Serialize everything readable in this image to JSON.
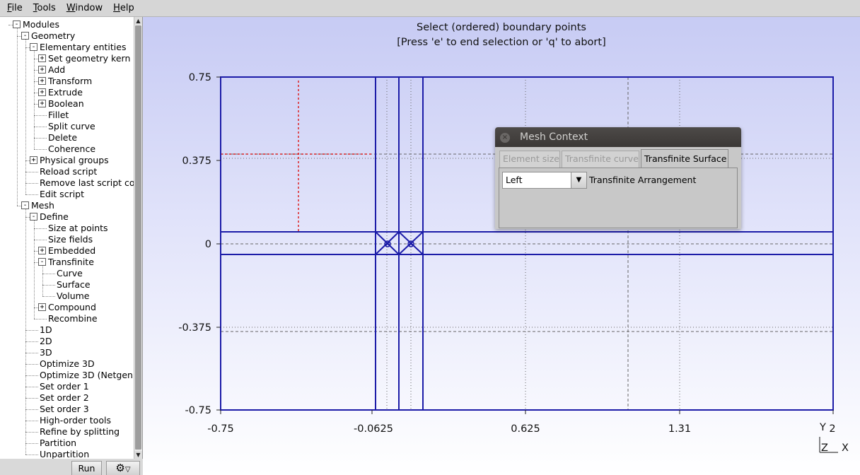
{
  "menu": {
    "items": [
      {
        "label_u": "F",
        "label_rest": "ile"
      },
      {
        "label_u": "T",
        "label_rest": "ools"
      },
      {
        "label_u": "W",
        "label_rest": "indow"
      },
      {
        "label_u": "H",
        "label_rest": "elp"
      }
    ]
  },
  "tree": {
    "items": [
      {
        "label": "Modules",
        "depth": 0,
        "toggle": "-"
      },
      {
        "label": "Geometry",
        "depth": 1,
        "toggle": "-"
      },
      {
        "label": "Elementary entities",
        "depth": 2,
        "toggle": "-"
      },
      {
        "label": "Set geometry kern",
        "depth": 3,
        "toggle": "+"
      },
      {
        "label": "Add",
        "depth": 3,
        "toggle": "+"
      },
      {
        "label": "Transform",
        "depth": 3,
        "toggle": "+"
      },
      {
        "label": "Extrude",
        "depth": 3,
        "toggle": "+"
      },
      {
        "label": "Boolean",
        "depth": 3,
        "toggle": "+"
      },
      {
        "label": "Fillet",
        "depth": 3,
        "toggle": ""
      },
      {
        "label": "Split curve",
        "depth": 3,
        "toggle": ""
      },
      {
        "label": "Delete",
        "depth": 3,
        "toggle": ""
      },
      {
        "label": "Coherence",
        "depth": 3,
        "toggle": ""
      },
      {
        "label": "Physical groups",
        "depth": 2,
        "toggle": "+"
      },
      {
        "label": "Reload script",
        "depth": 2,
        "toggle": ""
      },
      {
        "label": "Remove last script co",
        "depth": 2,
        "toggle": ""
      },
      {
        "label": "Edit script",
        "depth": 2,
        "toggle": ""
      },
      {
        "label": "Mesh",
        "depth": 1,
        "toggle": "-"
      },
      {
        "label": "Define",
        "depth": 2,
        "toggle": "-"
      },
      {
        "label": "Size at points",
        "depth": 3,
        "toggle": ""
      },
      {
        "label": "Size fields",
        "depth": 3,
        "toggle": ""
      },
      {
        "label": "Embedded",
        "depth": 3,
        "toggle": "+"
      },
      {
        "label": "Transfinite",
        "depth": 3,
        "toggle": "-"
      },
      {
        "label": "Curve",
        "depth": 4,
        "toggle": ""
      },
      {
        "label": "Surface",
        "depth": 4,
        "toggle": ""
      },
      {
        "label": "Volume",
        "depth": 4,
        "toggle": ""
      },
      {
        "label": "Compound",
        "depth": 3,
        "toggle": "+"
      },
      {
        "label": "Recombine",
        "depth": 3,
        "toggle": ""
      },
      {
        "label": "1D",
        "depth": 2,
        "toggle": ""
      },
      {
        "label": "2D",
        "depth": 2,
        "toggle": ""
      },
      {
        "label": "3D",
        "depth": 2,
        "toggle": ""
      },
      {
        "label": "Optimize 3D",
        "depth": 2,
        "toggle": ""
      },
      {
        "label": "Optimize 3D (Netgen",
        "depth": 2,
        "toggle": ""
      },
      {
        "label": "Set order 1",
        "depth": 2,
        "toggle": ""
      },
      {
        "label": "Set order 2",
        "depth": 2,
        "toggle": ""
      },
      {
        "label": "Set order 3",
        "depth": 2,
        "toggle": ""
      },
      {
        "label": "High-order tools",
        "depth": 2,
        "toggle": ""
      },
      {
        "label": "Refine by splitting",
        "depth": 2,
        "toggle": ""
      },
      {
        "label": "Partition",
        "depth": 2,
        "toggle": ""
      },
      {
        "label": "Unpartition",
        "depth": 2,
        "toggle": ""
      }
    ]
  },
  "bottom": {
    "run_label": "Run",
    "gear_icon": "⚙",
    "dropdown_icon": "▽"
  },
  "graphic": {
    "message_line1": "Select (ordered) boundary points",
    "message_line2": "[Press 'e' to end selection or 'q' to abort]",
    "x_ticks": [
      "-0.75",
      "-0.0625",
      "0.625",
      "1.31",
      "2"
    ],
    "y_ticks": [
      "0.75",
      "0.375",
      "0",
      "-0.375",
      "-0.75"
    ],
    "axes": {
      "y_label": "Y",
      "z_label": "Z",
      "x_label": "X"
    },
    "colors": {
      "geometry": "#1c1ca8",
      "highlight": "#dd2222",
      "grid": "#555555"
    }
  },
  "dialog": {
    "title": "Mesh Context",
    "close_icon": "×",
    "tabs": [
      {
        "label": "Element size",
        "active": false
      },
      {
        "label": "Transfinite curve",
        "active": false
      },
      {
        "label": "Transfinite Surface",
        "active": true
      }
    ],
    "select_value": "Left",
    "select_arrow": "▼",
    "field_label": "Transfinite Arrangement"
  }
}
